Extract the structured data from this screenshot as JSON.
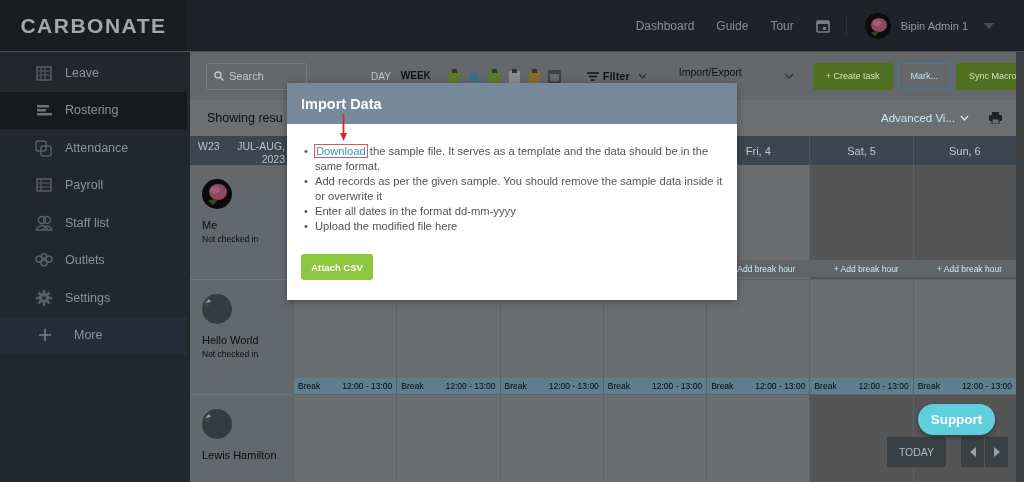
{
  "topbar": {
    "logo": "CARBONATE",
    "links": [
      "Dashboard",
      "Guide",
      "Tour"
    ],
    "user": {
      "name": "Bipin Admin 1"
    }
  },
  "sidebar": {
    "items": [
      {
        "label": "Leave",
        "selected": false,
        "kind": "item"
      },
      {
        "label": "Rostering",
        "selected": true,
        "kind": "item"
      },
      {
        "label": "Attendance",
        "selected": false,
        "kind": "item"
      },
      {
        "label": "Payroll",
        "selected": false,
        "kind": "item"
      },
      {
        "label": "Staff list",
        "selected": false,
        "kind": "item"
      },
      {
        "label": "Outlets",
        "selected": false,
        "kind": "item"
      },
      {
        "label": "Settings",
        "selected": false,
        "kind": "item"
      },
      {
        "label": "More",
        "selected": false,
        "kind": "more"
      }
    ]
  },
  "toolbar": {
    "search": {
      "placeholder": "Search"
    },
    "views": [
      {
        "label": "DAY",
        "selected": false
      },
      {
        "label": "WEEK",
        "selected": true
      }
    ],
    "filter": "Filter",
    "import_export": "Import/Export",
    "buttons": [
      {
        "label": "+ Create task",
        "kind": "primary"
      },
      {
        "label": "Mark...",
        "kind": "outline"
      },
      {
        "label": "Sync Macro",
        "kind": "primary"
      }
    ]
  },
  "results": {
    "summary": "Showing resu",
    "view_menu": "Advanced Vi..."
  },
  "roster": {
    "week": "W23",
    "period": "JUL-AUG, 2023",
    "days": [
      "Fri, 4",
      "Sat, 5",
      "Sun, 6"
    ],
    "rows": [
      {
        "name": "Me",
        "status": "Not checked in",
        "avatar": {
          "kind": "picture"
        },
        "cells": [
          "",
          "",
          "",
          "",
          {
            "shaded": false,
            "footer": {
              "kind": "add",
              "text": "Add break hour"
            }
          },
          {
            "shaded": true,
            "footer": {
              "kind": "add",
              "text": "+ Add break hour"
            }
          },
          {
            "shaded": true,
            "footer": {
              "kind": "add",
              "text": "+ Add break hour"
            }
          }
        ]
      },
      {
        "name": "Hello World",
        "status": "Not checked in",
        "cells": [
          {
            "shaded": false,
            "footer": {
              "kind": "break",
              "text": "Break",
              "time": "12:00 - 13:00"
            }
          },
          {
            "shaded": false,
            "footer": {
              "kind": "break",
              "text": "Break",
              "time": "12:00 - 13:00"
            }
          },
          {
            "shaded": false,
            "footer": {
              "kind": "break",
              "text": "Break",
              "time": "12:00 - 13:00"
            }
          },
          {
            "shaded": false,
            "footer": {
              "kind": "break",
              "text": "Break",
              "time": "12:00 - 13:00"
            }
          },
          {
            "shaded": false,
            "footer": {
              "kind": "break",
              "text": "Break",
              "time": "12:00 - 13:00"
            }
          },
          {
            "shaded": false,
            "footer": {
              "kind": "break",
              "text": "Break",
              "time": "12:00 - 13:00"
            }
          },
          {
            "shaded": false,
            "footer": {
              "kind": "break",
              "text": "Break",
              "time": "12:00 - 13:00"
            }
          }
        ]
      },
      {
        "name": "Lewis Hamilton",
        "cells": [
          {
            "shaded": false
          },
          {
            "shaded": false
          },
          {
            "shaded": false
          },
          {
            "shaded": false
          },
          {
            "shaded": false
          },
          {
            "shaded": true
          },
          {
            "shaded": true
          }
        ]
      }
    ]
  },
  "modal": {
    "title": "Import Data",
    "instructions": [
      {
        "bullet": "•",
        "link": "Download",
        "highlighted": true,
        "text": "the sample file. It serves as a template and the data should be in the same format."
      },
      {
        "bullet": "•",
        "text": "Add records as per the given sample. You should remove the sample data inside it or overwrite it"
      },
      {
        "bullet": "•",
        "text": "Enter all dates in the format dd-mm-yyyy"
      },
      {
        "bullet": "•",
        "text": "Upload the modified file here"
      }
    ],
    "button": "Attach CSV"
  },
  "floating": {
    "support": "Support",
    "today": "TODAY"
  }
}
